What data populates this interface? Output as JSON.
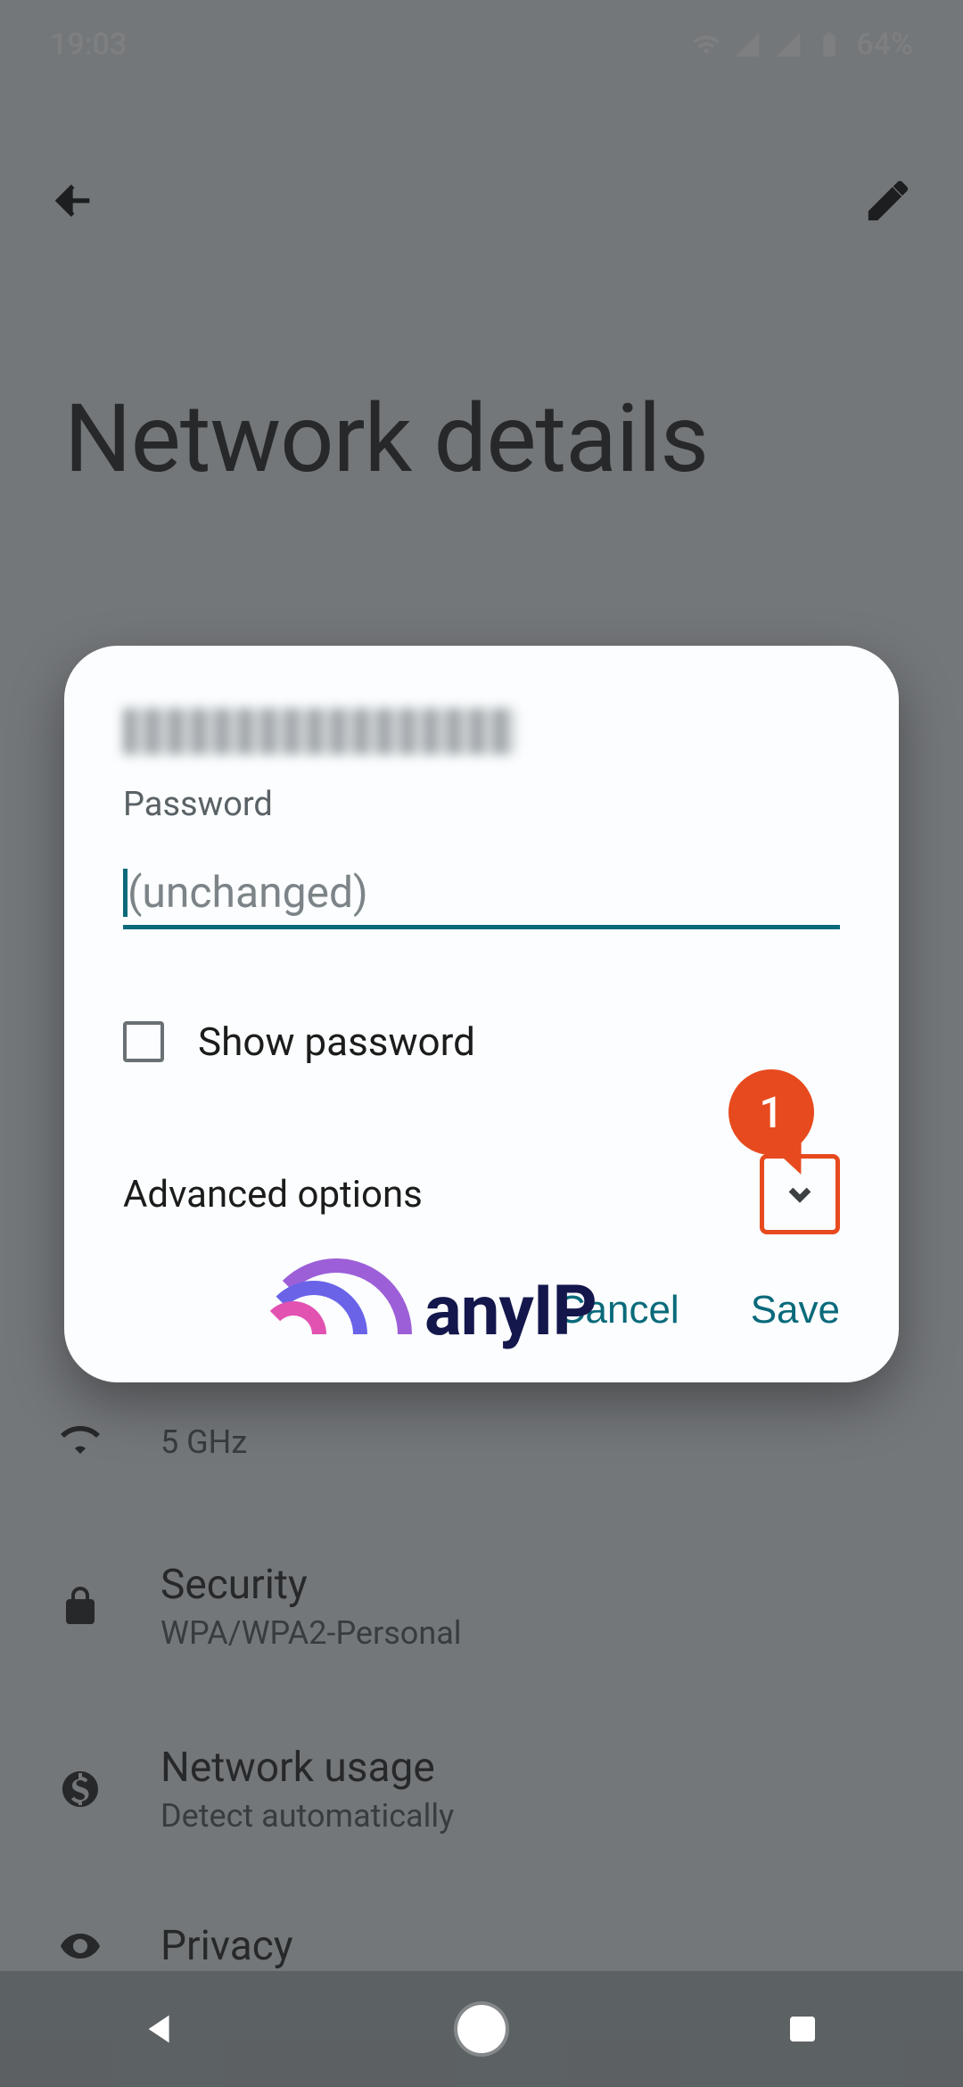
{
  "status": {
    "time": "19:03",
    "battery_pct": "64%"
  },
  "appbar": {
    "title": "Network details"
  },
  "dialog": {
    "password_label": "Password",
    "password_placeholder": "(unchanged)",
    "show_password_label": "Show password",
    "advanced_label": "Advanced options",
    "callout": "1",
    "cancel": "Cancel",
    "save": "Save",
    "logo_text": "anyIP"
  },
  "settings": {
    "frequency": {
      "title": "",
      "subtitle": "5 GHz"
    },
    "security": {
      "title": "Security",
      "subtitle": "WPA/WPA2-Personal"
    },
    "usage": {
      "title": "Network usage",
      "subtitle": "Detect automatically"
    },
    "privacy": {
      "title": "Privacy",
      "subtitle": ""
    }
  }
}
